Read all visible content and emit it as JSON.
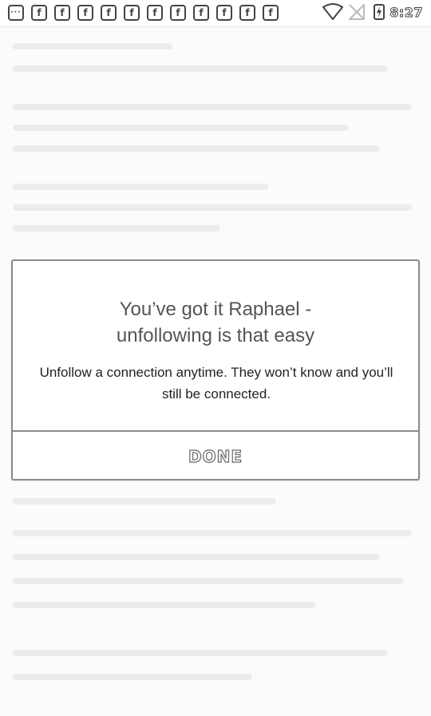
{
  "status_bar": {
    "notification_icons": [
      "more-icon",
      "facebook-icon",
      "facebook-icon",
      "facebook-icon",
      "facebook-icon",
      "facebook-icon",
      "facebook-icon",
      "facebook-icon",
      "facebook-icon",
      "facebook-icon",
      "facebook-icon",
      "facebook-icon"
    ],
    "more_glyph": "···",
    "facebook_glyph": "f",
    "time": "8:27"
  },
  "dialog": {
    "title_line1": "You’ve got it Raphael -",
    "title_line2": "unfollowing is that easy",
    "message": "Unfollow a connection anytime. They won’t know and you’ll still be connected.",
    "done_label": "DONE"
  },
  "colors": {
    "background": "#fbfbfb",
    "dialog_border": "#8a8a8a",
    "title_text": "#555555",
    "body_text": "#222222"
  }
}
